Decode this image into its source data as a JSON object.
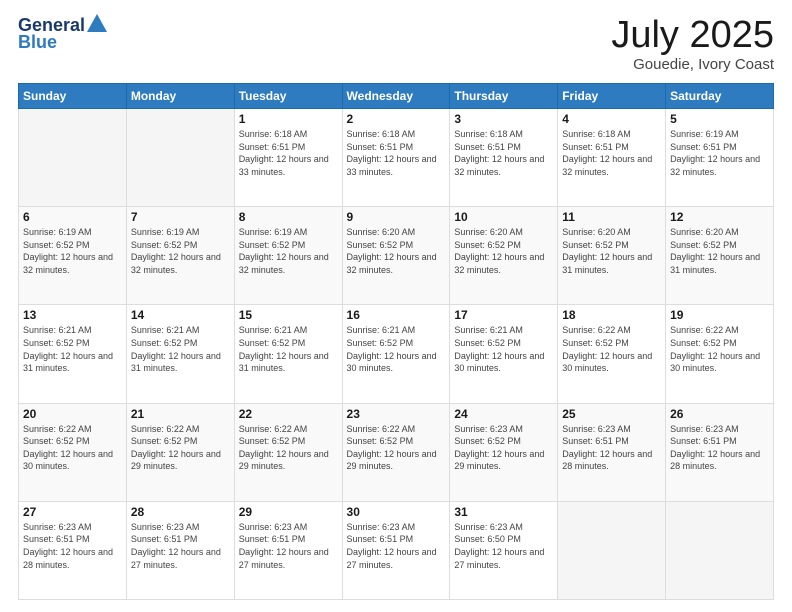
{
  "logo": {
    "general": "General",
    "blue": "Blue"
  },
  "header": {
    "month": "July 2025",
    "location": "Gouedie, Ivory Coast"
  },
  "weekdays": [
    "Sunday",
    "Monday",
    "Tuesday",
    "Wednesday",
    "Thursday",
    "Friday",
    "Saturday"
  ],
  "weeks": [
    [
      {
        "day": "",
        "sunrise": "",
        "sunset": "",
        "daylight": ""
      },
      {
        "day": "",
        "sunrise": "",
        "sunset": "",
        "daylight": ""
      },
      {
        "day": "1",
        "sunrise": "Sunrise: 6:18 AM",
        "sunset": "Sunset: 6:51 PM",
        "daylight": "Daylight: 12 hours and 33 minutes."
      },
      {
        "day": "2",
        "sunrise": "Sunrise: 6:18 AM",
        "sunset": "Sunset: 6:51 PM",
        "daylight": "Daylight: 12 hours and 33 minutes."
      },
      {
        "day": "3",
        "sunrise": "Sunrise: 6:18 AM",
        "sunset": "Sunset: 6:51 PM",
        "daylight": "Daylight: 12 hours and 32 minutes."
      },
      {
        "day": "4",
        "sunrise": "Sunrise: 6:18 AM",
        "sunset": "Sunset: 6:51 PM",
        "daylight": "Daylight: 12 hours and 32 minutes."
      },
      {
        "day": "5",
        "sunrise": "Sunrise: 6:19 AM",
        "sunset": "Sunset: 6:51 PM",
        "daylight": "Daylight: 12 hours and 32 minutes."
      }
    ],
    [
      {
        "day": "6",
        "sunrise": "Sunrise: 6:19 AM",
        "sunset": "Sunset: 6:52 PM",
        "daylight": "Daylight: 12 hours and 32 minutes."
      },
      {
        "day": "7",
        "sunrise": "Sunrise: 6:19 AM",
        "sunset": "Sunset: 6:52 PM",
        "daylight": "Daylight: 12 hours and 32 minutes."
      },
      {
        "day": "8",
        "sunrise": "Sunrise: 6:19 AM",
        "sunset": "Sunset: 6:52 PM",
        "daylight": "Daylight: 12 hours and 32 minutes."
      },
      {
        "day": "9",
        "sunrise": "Sunrise: 6:20 AM",
        "sunset": "Sunset: 6:52 PM",
        "daylight": "Daylight: 12 hours and 32 minutes."
      },
      {
        "day": "10",
        "sunrise": "Sunrise: 6:20 AM",
        "sunset": "Sunset: 6:52 PM",
        "daylight": "Daylight: 12 hours and 32 minutes."
      },
      {
        "day": "11",
        "sunrise": "Sunrise: 6:20 AM",
        "sunset": "Sunset: 6:52 PM",
        "daylight": "Daylight: 12 hours and 31 minutes."
      },
      {
        "day": "12",
        "sunrise": "Sunrise: 6:20 AM",
        "sunset": "Sunset: 6:52 PM",
        "daylight": "Daylight: 12 hours and 31 minutes."
      }
    ],
    [
      {
        "day": "13",
        "sunrise": "Sunrise: 6:21 AM",
        "sunset": "Sunset: 6:52 PM",
        "daylight": "Daylight: 12 hours and 31 minutes."
      },
      {
        "day": "14",
        "sunrise": "Sunrise: 6:21 AM",
        "sunset": "Sunset: 6:52 PM",
        "daylight": "Daylight: 12 hours and 31 minutes."
      },
      {
        "day": "15",
        "sunrise": "Sunrise: 6:21 AM",
        "sunset": "Sunset: 6:52 PM",
        "daylight": "Daylight: 12 hours and 31 minutes."
      },
      {
        "day": "16",
        "sunrise": "Sunrise: 6:21 AM",
        "sunset": "Sunset: 6:52 PM",
        "daylight": "Daylight: 12 hours and 30 minutes."
      },
      {
        "day": "17",
        "sunrise": "Sunrise: 6:21 AM",
        "sunset": "Sunset: 6:52 PM",
        "daylight": "Daylight: 12 hours and 30 minutes."
      },
      {
        "day": "18",
        "sunrise": "Sunrise: 6:22 AM",
        "sunset": "Sunset: 6:52 PM",
        "daylight": "Daylight: 12 hours and 30 minutes."
      },
      {
        "day": "19",
        "sunrise": "Sunrise: 6:22 AM",
        "sunset": "Sunset: 6:52 PM",
        "daylight": "Daylight: 12 hours and 30 minutes."
      }
    ],
    [
      {
        "day": "20",
        "sunrise": "Sunrise: 6:22 AM",
        "sunset": "Sunset: 6:52 PM",
        "daylight": "Daylight: 12 hours and 30 minutes."
      },
      {
        "day": "21",
        "sunrise": "Sunrise: 6:22 AM",
        "sunset": "Sunset: 6:52 PM",
        "daylight": "Daylight: 12 hours and 29 minutes."
      },
      {
        "day": "22",
        "sunrise": "Sunrise: 6:22 AM",
        "sunset": "Sunset: 6:52 PM",
        "daylight": "Daylight: 12 hours and 29 minutes."
      },
      {
        "day": "23",
        "sunrise": "Sunrise: 6:22 AM",
        "sunset": "Sunset: 6:52 PM",
        "daylight": "Daylight: 12 hours and 29 minutes."
      },
      {
        "day": "24",
        "sunrise": "Sunrise: 6:23 AM",
        "sunset": "Sunset: 6:52 PM",
        "daylight": "Daylight: 12 hours and 29 minutes."
      },
      {
        "day": "25",
        "sunrise": "Sunrise: 6:23 AM",
        "sunset": "Sunset: 6:51 PM",
        "daylight": "Daylight: 12 hours and 28 minutes."
      },
      {
        "day": "26",
        "sunrise": "Sunrise: 6:23 AM",
        "sunset": "Sunset: 6:51 PM",
        "daylight": "Daylight: 12 hours and 28 minutes."
      }
    ],
    [
      {
        "day": "27",
        "sunrise": "Sunrise: 6:23 AM",
        "sunset": "Sunset: 6:51 PM",
        "daylight": "Daylight: 12 hours and 28 minutes."
      },
      {
        "day": "28",
        "sunrise": "Sunrise: 6:23 AM",
        "sunset": "Sunset: 6:51 PM",
        "daylight": "Daylight: 12 hours and 27 minutes."
      },
      {
        "day": "29",
        "sunrise": "Sunrise: 6:23 AM",
        "sunset": "Sunset: 6:51 PM",
        "daylight": "Daylight: 12 hours and 27 minutes."
      },
      {
        "day": "30",
        "sunrise": "Sunrise: 6:23 AM",
        "sunset": "Sunset: 6:51 PM",
        "daylight": "Daylight: 12 hours and 27 minutes."
      },
      {
        "day": "31",
        "sunrise": "Sunrise: 6:23 AM",
        "sunset": "Sunset: 6:50 PM",
        "daylight": "Daylight: 12 hours and 27 minutes."
      },
      {
        "day": "",
        "sunrise": "",
        "sunset": "",
        "daylight": ""
      },
      {
        "day": "",
        "sunrise": "",
        "sunset": "",
        "daylight": ""
      }
    ]
  ]
}
